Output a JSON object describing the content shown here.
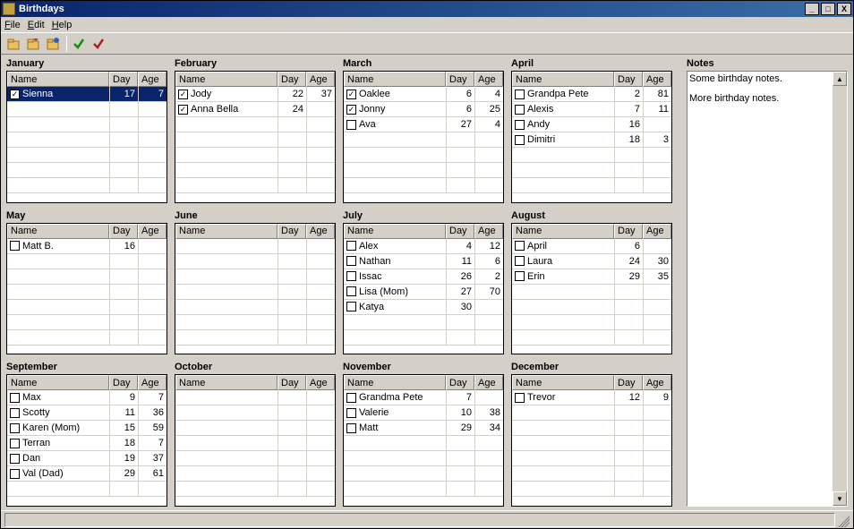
{
  "window": {
    "title": "Birthdays"
  },
  "menu": {
    "file": "File",
    "edit": "Edit",
    "help": "Help"
  },
  "toolbar_icons": [
    "folder1",
    "folder2",
    "folder3",
    "check-green",
    "check-red"
  ],
  "columns": {
    "name": "Name",
    "day": "Day",
    "age": "Age"
  },
  "months": [
    {
      "title": "January",
      "rows": [
        {
          "checked": true,
          "selected": true,
          "name": "Sienna",
          "day": "17",
          "age": "7"
        }
      ]
    },
    {
      "title": "February",
      "rows": [
        {
          "checked": true,
          "name": "Jody",
          "day": "22",
          "age": "37"
        },
        {
          "checked": true,
          "name": "Anna Bella",
          "day": "24",
          "age": ""
        }
      ]
    },
    {
      "title": "March",
      "rows": [
        {
          "checked": true,
          "name": "Oaklee",
          "day": "6",
          "age": "4"
        },
        {
          "checked": true,
          "name": "Jonny",
          "day": "6",
          "age": "25"
        },
        {
          "checked": false,
          "name": "Ava",
          "day": "27",
          "age": "4"
        }
      ]
    },
    {
      "title": "April",
      "rows": [
        {
          "checked": false,
          "name": "Grandpa Pete",
          "day": "2",
          "age": "81"
        },
        {
          "checked": false,
          "name": "Alexis",
          "day": "7",
          "age": "11"
        },
        {
          "checked": false,
          "name": "Andy",
          "day": "16",
          "age": ""
        },
        {
          "checked": false,
          "name": "Dimitri",
          "day": "18",
          "age": "3"
        }
      ]
    },
    {
      "title": "May",
      "rows": [
        {
          "checked": false,
          "name": "Matt B.",
          "day": "16",
          "age": ""
        }
      ]
    },
    {
      "title": "June",
      "rows": []
    },
    {
      "title": "July",
      "rows": [
        {
          "checked": false,
          "name": "Alex",
          "day": "4",
          "age": "12"
        },
        {
          "checked": false,
          "name": "Nathan",
          "day": "11",
          "age": "6"
        },
        {
          "checked": false,
          "name": "Issac",
          "day": "26",
          "age": "2"
        },
        {
          "checked": false,
          "name": "Lisa (Mom)",
          "day": "27",
          "age": "70"
        },
        {
          "checked": false,
          "name": "Katya",
          "day": "30",
          "age": ""
        }
      ]
    },
    {
      "title": "August",
      "rows": [
        {
          "checked": false,
          "name": "April",
          "day": "6",
          "age": ""
        },
        {
          "checked": false,
          "name": "Laura",
          "day": "24",
          "age": "30"
        },
        {
          "checked": false,
          "name": "Erin",
          "day": "29",
          "age": "35"
        }
      ]
    },
    {
      "title": "September",
      "rows": [
        {
          "checked": false,
          "name": "Max",
          "day": "9",
          "age": "7"
        },
        {
          "checked": false,
          "name": "Scotty",
          "day": "11",
          "age": "36"
        },
        {
          "checked": false,
          "name": "Karen (Mom)",
          "day": "15",
          "age": "59"
        },
        {
          "checked": false,
          "name": "Terran",
          "day": "18",
          "age": "7"
        },
        {
          "checked": false,
          "name": "Dan",
          "day": "19",
          "age": "37"
        },
        {
          "checked": false,
          "name": "Val (Dad)",
          "day": "29",
          "age": "61"
        }
      ]
    },
    {
      "title": "October",
      "rows": []
    },
    {
      "title": "November",
      "rows": [
        {
          "checked": false,
          "name": "Grandma Pete",
          "day": "7",
          "age": ""
        },
        {
          "checked": false,
          "name": "Valerie",
          "day": "10",
          "age": "38"
        },
        {
          "checked": false,
          "name": "Matt",
          "day": "29",
          "age": "34"
        }
      ]
    },
    {
      "title": "December",
      "rows": [
        {
          "checked": false,
          "name": "Trevor",
          "day": "12",
          "age": "9"
        }
      ]
    }
  ],
  "notes": {
    "title": "Notes",
    "lines": [
      "Some birthday notes.",
      "More birthday notes."
    ]
  }
}
